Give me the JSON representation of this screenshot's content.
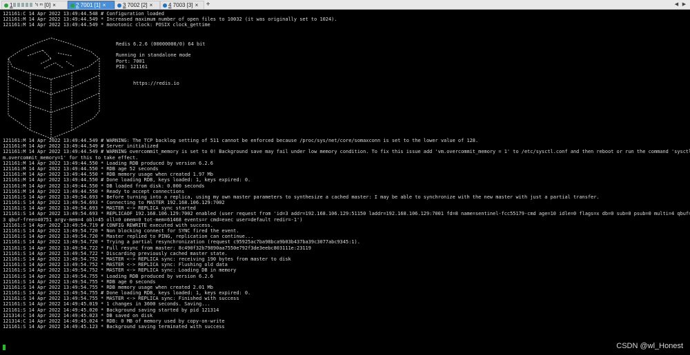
{
  "tabs": [
    {
      "num": "1",
      "label": " 'ᵑ ᵐ [0]",
      "status": "green"
    },
    {
      "num": "2",
      "label": " 7001 [1]",
      "status": "green"
    },
    {
      "num": "3",
      "label": " 7002 [2]",
      "status": "blue"
    },
    {
      "num": "4",
      "label": " 7003 [3]",
      "status": "blue"
    }
  ],
  "terminal": {
    "top_lines": [
      "121161:C 14 Apr 2022 13:49:44.548 # Configuration loaded",
      "121161:M 14 Apr 2022 13:49:44.549 * Increased maximum number of open files to 10032 (it was originally set to 1024).",
      "121161:M 14 Apr 2022 13:49:44.549 * monotonic clock: POSIX clock_gettime"
    ],
    "banner": {
      "version": "Redis 6.2.6 (00000000/0) 64 bit",
      "mode": "Running in standalone mode",
      "port": "Port: 7001",
      "pid": "PID: 121161",
      "url": "https://redis.io"
    },
    "lower_lines": [
      "121161:M 14 Apr 2022 13:49:44.549 # WARNING: The TCP backlog setting of 511 cannot be enforced because /proc/sys/net/core/somaxconn is set to the lower value of 128.",
      "121161:M 14 Apr 2022 13:49:44.549 # Server initialized",
      "121161:M 14 Apr 2022 13:49:44.549 # WARNING overcommit_memory is set to 0! Background save may fail under low memory condition. To fix this issue add 'vm.overcommit_memory = 1' to /etc/sysctl.conf and then reboot or run the command 'sysctl v",
      "m.overcommit_memory=1' for this to take effect.",
      "121161:M 14 Apr 2022 13:49:44.550 * Loading RDB produced by version 6.2.6",
      "121161:M 14 Apr 2022 13:49:44.550 * RDB age 52 seconds",
      "121161:M 14 Apr 2022 13:49:44.550 * RDB memory usage when created 1.97 Mb",
      "121161:M 14 Apr 2022 13:49:44.550 # Done loading RDB, keys loaded: 1, keys expired: 0.",
      "121161:M 14 Apr 2022 13:49:44.550 * DB loaded from disk: 0.000 seconds",
      "121161:M 14 Apr 2022 13:49:44.550 * Ready to accept connections",
      "121161:S 14 Apr 2022 13:49:54.693 * Before turning into a replica, using my own master parameters to synthesize a cached master: I may be able to synchronize with the new master with just a partial transfer.",
      "121161:S 14 Apr 2022 13:49:54.693 * Connecting to MASTER 192.168.106.129:7002",
      "121161:S 14 Apr 2022 13:49:54.693 * MASTER <-> REPLICA sync started",
      "121161:S 14 Apr 2022 13:49:54.693 * REPLICAOF 192.168.106.129:7002 enabled (user request from 'id=3 addr=192.168.106.129:51150 laddr=192.168.106.129:7001 fd=8 name=sentinel-fcc55179-cmd age=10 idle=0 flags=x db=0 sub=0 psub=0 multi=4 qbuf=20",
      "3 qbuf-free=40751 argv-mem=4 obl=45 oll=0 omem=0 tot-mem=61468 events=r cmd=exec user=default redir=-1')",
      "121161:S 14 Apr 2022 13:49:54.719 # CONFIG REWRITE executed with success.",
      "121161:S 14 Apr 2022 13:49:54.720 * Non blocking connect for SYNC fired the event.",
      "121161:S 14 Apr 2022 13:49:54.720 * Master replied to PING, replication can continue...",
      "121161:S 14 Apr 2022 13:49:54.720 * Trying a partial resynchronization (request c95925ac7ba98bca9b03b437ba39c3077abc9345:1).",
      "121161:S 14 Apr 2022 13:49:54.722 * Full resync from master: 8c490f32b79890aa7550e792f3de3eebc803111e:23119",
      "121161:S 14 Apr 2022 13:49:54.722 * Discarding previously cached master state.",
      "121161:S 14 Apr 2022 13:49:54.752 * MASTER <-> REPLICA sync: receiving 190 bytes from master to disk",
      "121161:S 14 Apr 2022 13:49:54.752 * MASTER <-> REPLICA sync: Flushing old data",
      "121161:S 14 Apr 2022 13:49:54.752 * MASTER <-> REPLICA sync: Loading DB in memory",
      "121161:S 14 Apr 2022 13:49:54.755 * Loading RDB produced by version 6.2.6",
      "121161:S 14 Apr 2022 13:49:54.755 * RDB age 0 seconds",
      "121161:S 14 Apr 2022 13:49:54.755 * RDB memory usage when created 2.01 Mb",
      "121161:S 14 Apr 2022 13:49:54.755 # Done loading RDB, keys loaded: 1, keys expired: 0.",
      "121161:S 14 Apr 2022 13:49:54.755 * MASTER <-> REPLICA sync: Finished with success",
      "121161:S 14 Apr 2022 14:49:45.019 * 1 changes in 3600 seconds. Saving...",
      "121161:S 14 Apr 2022 14:49:45.020 * Background saving started by pid 121314",
      "121314:C 14 Apr 2022 14:49:45.023 * DB saved on disk",
      "121314:C 14 Apr 2022 14:49:45.024 * RDB: 0 MB of memory used by copy-on-write",
      "121161:S 14 Apr 2022 14:49:45.123 * Background saving terminated with success"
    ]
  },
  "watermark": "CSDN @wl_Honest",
  "colors": {
    "active_tab": "#4a90d9",
    "cursor": "#20c020",
    "terminal_bg": "#000000"
  }
}
